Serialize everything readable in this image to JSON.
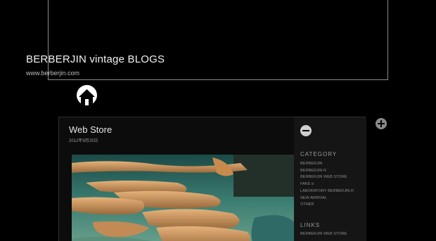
{
  "header": {
    "title": "BERBERJIN vintage BLOGS",
    "url": "www.berberjin.com"
  },
  "post": {
    "title": "Web Store",
    "date": "2012年9月25日"
  },
  "sidebar": {
    "category_heading": "CATEGORY",
    "categories": [
      "BERBERJIN",
      "BERBERJIN R",
      "BERBERJIN WEB STORE",
      "FAKE α",
      "LABORATORY BERBERJIN R",
      "NEW ARRIVAL",
      "OTHER"
    ],
    "links_heading": "LINKS",
    "links": [
      "BERBERJIN WEB STORE"
    ]
  },
  "icons": {
    "home": "home-icon",
    "expand": "plus-circle-icon",
    "collapse": "minus-circle-icon"
  }
}
